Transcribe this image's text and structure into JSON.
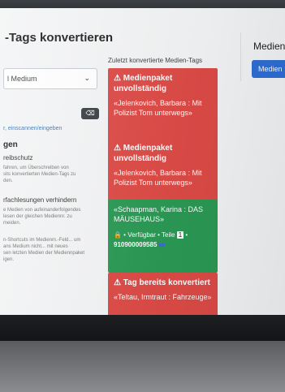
{
  "page": {
    "title": "-Tags konvertieren"
  },
  "left": {
    "select_value": "l Medium",
    "clear_label": "⌫",
    "scan_link": "r, einscannen/eingeben",
    "section_head": "gen",
    "options": [
      {
        "title": "reibschutz",
        "desc": "fahren, um Überschreiben von\nsits konvertierten Medien-Tags zu\nden."
      },
      {
        "title": "rfachlesungen verhindern",
        "desc": "e Medien von aufeinanderfolgendes\nlesen der gleichen Mediennr. zu\nmeiden."
      },
      {
        "title": "",
        "desc": "n-Shortcuts im Medienm.-Feld... um\nans Medium nicht... mit neues\nsen letzten Medien der Mediennpaket\nigen."
      }
    ]
  },
  "middle": {
    "heading": "Zuletzt konvertierte Medien-Tags",
    "cards": [
      {
        "color": "#de4b47",
        "title": "⚠ Medienpaket unvollständig",
        "text": "«Jelenkovich, Barbara : Mit Polizist Tom unterwegs»"
      },
      {
        "color": "#de4b47",
        "title": "⚠ Medienpaket unvollständig",
        "text": "«Jelenkovich, Barbara : Mit Polizist Tom unterwegs»"
      },
      {
        "color": "#2b9a55",
        "text": "«Schaapman, Karina : DAS MÄUSEHAUS»",
        "meta_prefix": "🔒 • Verfügbar • Teile",
        "part_num": "1",
        "meta_suffix": "•",
        "id": "910900009585"
      },
      {
        "color": "#de4b47",
        "title": "⚠ Tag bereits konvertiert",
        "text": "«Teltau, Irmtraut : Fahrzeuge»"
      }
    ]
  },
  "right": {
    "title": "Medien",
    "button": "Medien"
  }
}
